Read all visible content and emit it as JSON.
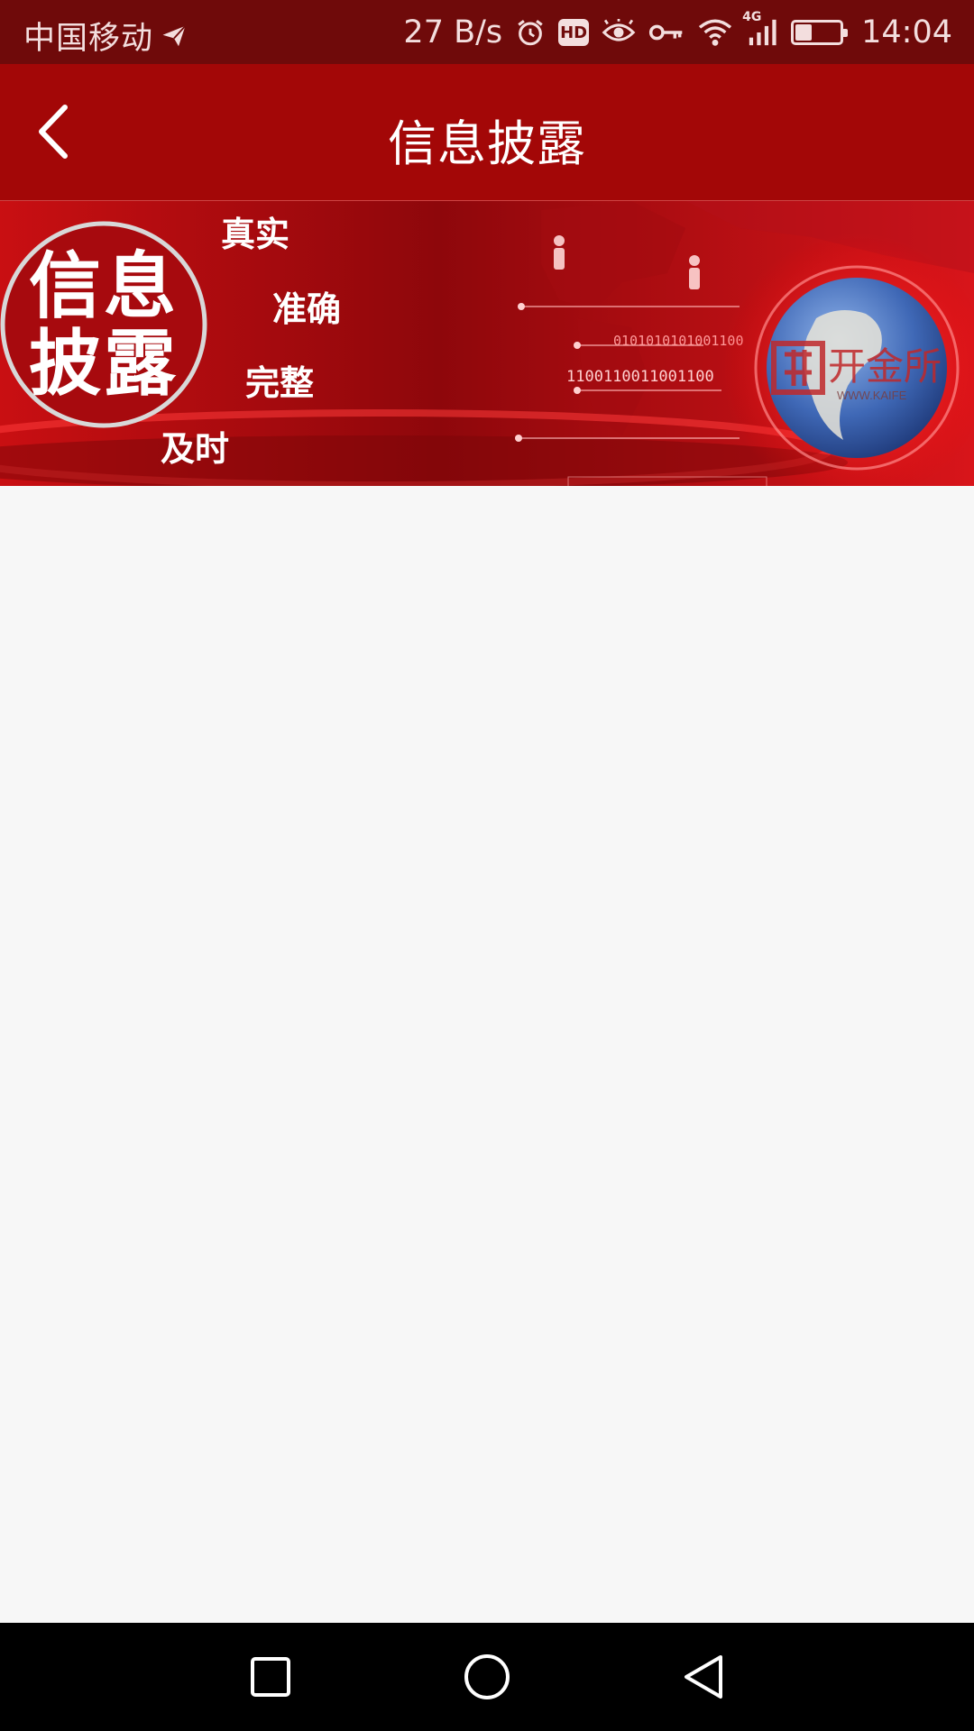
{
  "status_bar": {
    "carrier": "中国移动",
    "net_speed": "27 B/s",
    "hd_label": "HD",
    "network_type": "4G",
    "battery_level": 0.35,
    "time": "14:04"
  },
  "app_bar": {
    "title": "信息披露",
    "back_icon": "chevron-left-icon"
  },
  "banner": {
    "circle_chars": [
      "信",
      "息",
      "披",
      "露"
    ],
    "keywords": [
      "真实",
      "准确",
      "完整",
      "及时"
    ],
    "binary_lines": [
      "0101010101001100",
      "1100110011001100"
    ],
    "logo_text": "开金所",
    "logo_url_text": "WWW.KAIFE"
  },
  "nav_bar": {
    "recent_icon": "square-icon",
    "home_icon": "circle-icon",
    "back_icon": "triangle-back-icon"
  },
  "colors": {
    "status_bar_bg": "#6f0a0a",
    "app_bar_bg": "#a30707",
    "content_bg": "#f7f7f7",
    "nav_bar_bg": "#000000"
  }
}
